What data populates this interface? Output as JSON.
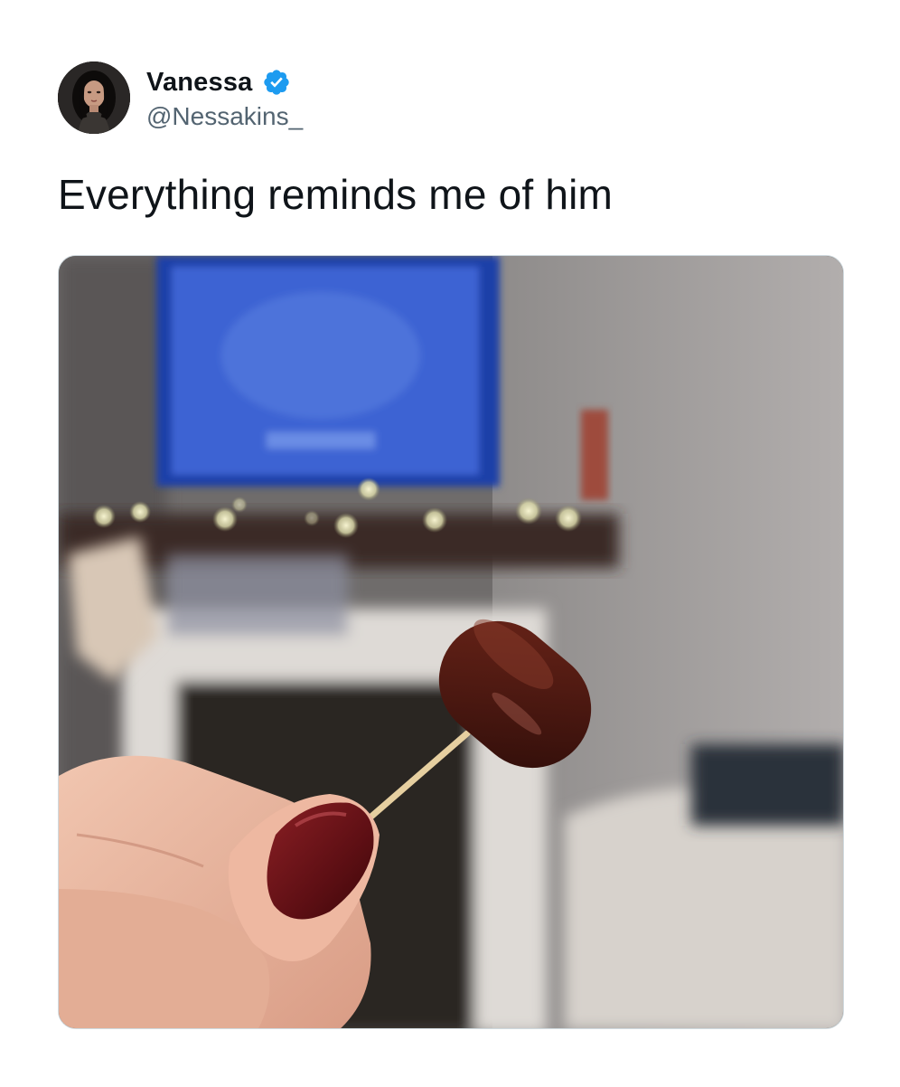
{
  "author": {
    "display_name": "Vanessa",
    "handle": "@Nessakins_",
    "verified": true,
    "verified_icon": "verified-badge-icon",
    "avatar_icon": "avatar-photo"
  },
  "tweet": {
    "text": "Everything reminds me of him"
  },
  "media": {
    "type": "photo",
    "subject": "hand with dark red nail polish holding a glazed cocktail sausage on a toothpick, blurred living room with TV, string lights and fireplace behind"
  },
  "colors": {
    "text_primary": "#0f1419",
    "text_secondary": "#536471",
    "verified_blue": "#1d9bf0",
    "media_border": "#cfd9de"
  }
}
